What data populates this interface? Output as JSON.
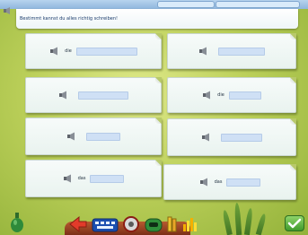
{
  "instruction": {
    "text": "Bestimmt kannst du alles richtig schreiben!"
  },
  "exercise": {
    "cards": [
      {
        "word": "die",
        "answer": ""
      },
      {
        "word": "",
        "answer": ""
      },
      {
        "word": "",
        "answer": ""
      },
      {
        "word": "die",
        "answer": ""
      },
      {
        "word": "",
        "answer": ""
      },
      {
        "word": "",
        "answer": ""
      },
      {
        "word": "das",
        "answer": ""
      },
      {
        "word": "das",
        "answer": ""
      }
    ]
  },
  "toolbar": {
    "items": [
      {
        "icon": "red-arrow-icon"
      },
      {
        "icon": "keyboard-icon"
      },
      {
        "icon": "lifebuoy-icon"
      },
      {
        "icon": "green-helmet-icon"
      },
      {
        "icon": "books-icon"
      },
      {
        "icon": "bar-chart-icon"
      }
    ],
    "ok_icon": "checkmark-icon",
    "left_icon": "green-bottle-icon"
  },
  "colors": {
    "background": "#bcd05a",
    "answer_field": "#cfe0f5",
    "card": "#f2f8f5",
    "topbar": "#8fb6dd"
  }
}
